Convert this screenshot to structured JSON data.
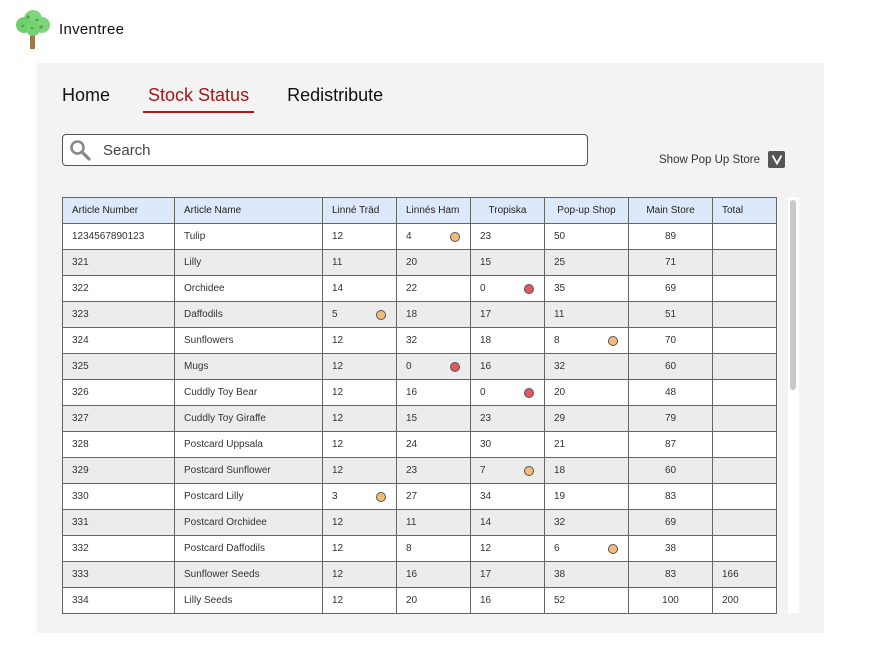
{
  "app": {
    "name": "Inventree"
  },
  "nav": {
    "items": [
      "Home",
      "Stock Status",
      "Redistribute"
    ],
    "active": "Stock Status"
  },
  "search": {
    "placeholder": "Search"
  },
  "popup_toggle": {
    "label": "Show Pop Up Store",
    "checked": true
  },
  "colors": {
    "accent": "#a31818",
    "header_bg": "#dde9fa",
    "flag_orange": "#f4bc78",
    "flag_red": "#e0585f"
  },
  "table": {
    "headers": [
      "Article Number",
      "Article Name",
      "Linné Träd",
      "Linnés Ham",
      "Tropiska",
      "Pop-up Shop",
      "Main Store",
      "Total"
    ],
    "rows": [
      {
        "cells": [
          "1234567890123",
          "Tulip",
          "12",
          "4",
          "23",
          "50",
          "89",
          ""
        ],
        "flags": {
          "3": "orange"
        }
      },
      {
        "cells": [
          "321",
          "Lilly",
          "11",
          "20",
          "15",
          "25",
          "71",
          ""
        ],
        "flags": {}
      },
      {
        "cells": [
          "322",
          "Orchidee",
          "14",
          "22",
          "0",
          "35",
          "69",
          ""
        ],
        "flags": {
          "4": "red"
        }
      },
      {
        "cells": [
          "323",
          "Daffodils",
          "5",
          "18",
          "17",
          "11",
          "51",
          ""
        ],
        "flags": {
          "2": "orange"
        }
      },
      {
        "cells": [
          "324",
          "Sunflowers",
          "12",
          "32",
          "18",
          "8",
          "70",
          ""
        ],
        "flags": {
          "5": "orange"
        }
      },
      {
        "cells": [
          "325",
          "Mugs",
          "12",
          "0",
          "16",
          "32",
          "60",
          ""
        ],
        "flags": {
          "3": "red"
        }
      },
      {
        "cells": [
          "326",
          "Cuddly Toy Bear",
          "12",
          "16",
          "0",
          "20",
          "48",
          ""
        ],
        "flags": {
          "4": "red"
        }
      },
      {
        "cells": [
          "327",
          "Cuddly Toy Giraffe",
          "12",
          "15",
          "23",
          "29",
          "79",
          ""
        ],
        "flags": {}
      },
      {
        "cells": [
          "328",
          "Postcard Uppsala",
          "12",
          "24",
          "30",
          "21",
          "87",
          ""
        ],
        "flags": {}
      },
      {
        "cells": [
          "329",
          "Postcard Sunflower",
          "12",
          "23",
          "7",
          "18",
          "60",
          ""
        ],
        "flags": {
          "4": "orange"
        }
      },
      {
        "cells": [
          "330",
          "Postcard Lilly",
          "3",
          "27",
          "34",
          "19",
          "83",
          ""
        ],
        "flags": {
          "2": "orange"
        }
      },
      {
        "cells": [
          "331",
          "Postcard Orchidee",
          "12",
          "11",
          "14",
          "32",
          "69",
          ""
        ],
        "flags": {}
      },
      {
        "cells": [
          "332",
          "Postcard Daffodils",
          "12",
          "8",
          "12",
          "6",
          "38",
          ""
        ],
        "flags": {
          "5": "orange"
        }
      },
      {
        "cells": [
          "333",
          "Sunflower Seeds",
          "12",
          "16",
          "17",
          "38",
          "83",
          "166"
        ],
        "flags": {}
      },
      {
        "cells": [
          "334",
          "Lilly Seeds",
          "12",
          "20",
          "16",
          "52",
          "100",
          "200"
        ],
        "flags": {}
      }
    ]
  }
}
